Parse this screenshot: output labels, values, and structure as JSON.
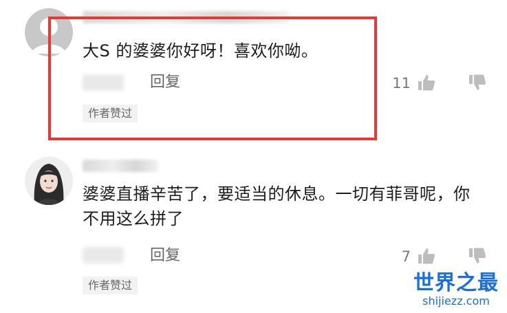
{
  "comments": [
    {
      "text": "大S 的婆婆你好呀！喜欢你呦。",
      "reply_label": "回复",
      "like_count": "11",
      "badge": "作者赞过",
      "highlighted": true
    },
    {
      "text": "婆婆直播辛苦了，要适当的休息。一切有菲哥呢，你不用这么拼了",
      "reply_label": "回复",
      "like_count": "7",
      "badge": "作者赞过",
      "highlighted": false
    }
  ],
  "icons": {
    "like": "thumbs-up-icon",
    "dislike": "thumbs-down-icon"
  },
  "colors": {
    "highlight": "#e53935",
    "watermark": "#1a6fe0"
  },
  "watermark": {
    "title": "世界之最",
    "url": "shijiezz.com"
  }
}
